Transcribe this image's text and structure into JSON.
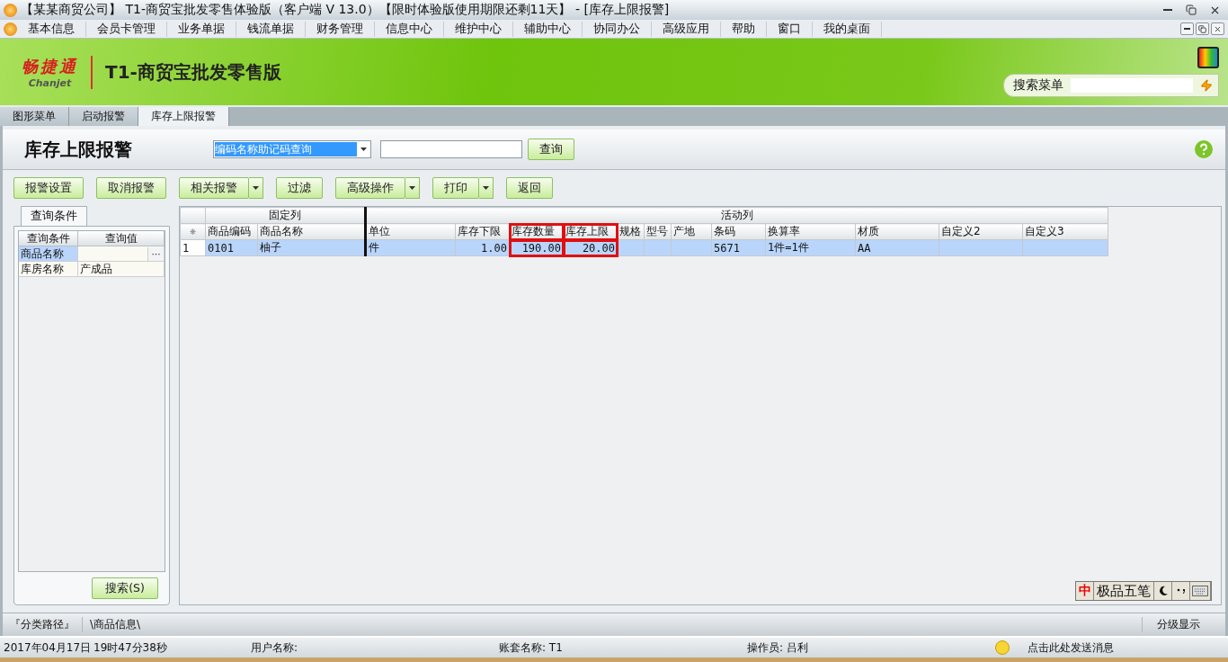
{
  "window": {
    "title": "【某某商贸公司】 T1-商贸宝批发零售体验版（客户端 V 13.0）【限时体验版使用期限还剩11天】 - [库存上限报警]"
  },
  "menu": [
    "基本信息",
    "会员卡管理",
    "业务单据",
    "钱流单据",
    "财务管理",
    "信息中心",
    "维护中心",
    "辅助中心",
    "协同办公",
    "高级应用",
    "帮助",
    "窗口",
    "我的桌面"
  ],
  "banner": {
    "logo": "畅捷通",
    "logo_sub": "Chanjet",
    "product": "T1-商贸宝批发零售版",
    "search_label": "搜索菜单"
  },
  "tabs": [
    {
      "label": "图形菜单",
      "selected": false
    },
    {
      "label": "启动报警",
      "selected": false
    },
    {
      "label": "库存上限报警",
      "selected": true
    }
  ],
  "page": {
    "title": "库存上限报警",
    "query_mode": "编码名称助记码查询",
    "query_button": "查询"
  },
  "toolbar": [
    {
      "label": "报警设置",
      "dropdown": false
    },
    {
      "label": "取消报警",
      "dropdown": false
    },
    {
      "label": "相关报警",
      "dropdown": true
    },
    {
      "label": "过滤",
      "dropdown": false
    },
    {
      "label": "高级操作",
      "dropdown": true
    },
    {
      "label": "打印",
      "dropdown": true
    },
    {
      "label": "返回",
      "dropdown": false
    }
  ],
  "query_panel": {
    "tab": "查询条件",
    "columns": [
      "查询条件",
      "查询值"
    ],
    "rows": [
      {
        "name": "商品名称",
        "value": "",
        "selected": true,
        "picker": "···"
      },
      {
        "name": "库房名称",
        "value": "产成品",
        "selected": false
      }
    ],
    "search_button": "搜索(S)"
  },
  "table": {
    "corner": "⁕",
    "groups": [
      {
        "label": "固定列",
        "columns": [
          {
            "label": "商品编码",
            "highlighted": false
          },
          {
            "label": "商品名称",
            "highlighted": false
          }
        ]
      },
      {
        "label": "活动列",
        "columns": [
          {
            "label": "单位",
            "highlighted": false
          },
          {
            "label": "库存下限",
            "highlighted": false
          },
          {
            "label": "库存数量",
            "highlighted": true
          },
          {
            "label": "库存上限",
            "highlighted": true
          },
          {
            "label": "规格",
            "highlighted": false
          },
          {
            "label": "型号",
            "highlighted": false
          },
          {
            "label": "产地",
            "highlighted": false
          },
          {
            "label": "条码",
            "highlighted": false
          },
          {
            "label": "换算率",
            "highlighted": false
          },
          {
            "label": "材质",
            "highlighted": false
          },
          {
            "label": "自定义2",
            "highlighted": false
          },
          {
            "label": "自定义3",
            "highlighted": false
          }
        ]
      }
    ],
    "rows": [
      {
        "number": "1",
        "selected": true,
        "cells": [
          "0101",
          "柚子",
          "件",
          "1.00",
          "190.00",
          "20.00",
          "",
          "",
          "",
          "5671",
          "1件=1件",
          "AA",
          "",
          ""
        ]
      }
    ]
  },
  "ime": {
    "mode": "中",
    "label": "极品五笔"
  },
  "path_bar": {
    "label": "『分类路径』",
    "path": "\\商品信息\\",
    "right": "分级显示"
  },
  "status_bar": [
    {
      "kind": "text",
      "text": "2017年04月17日"
    },
    {
      "kind": "text",
      "text": "19时47分38秒"
    },
    {
      "kind": "text",
      "text": "用户名称:"
    },
    {
      "kind": "text",
      "text": "账套名称: T1"
    },
    {
      "kind": "text",
      "text": "操作员: 吕利"
    },
    {
      "kind": "message",
      "text": "点击此处发送消息"
    }
  ]
}
